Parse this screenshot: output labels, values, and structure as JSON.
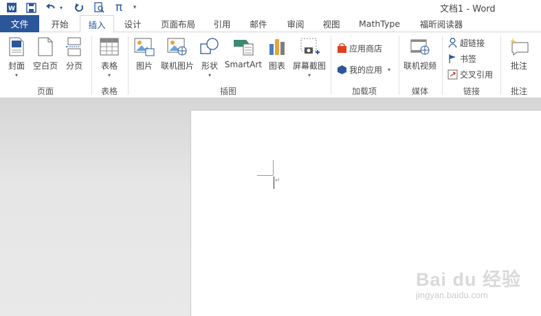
{
  "window": {
    "title": "文档1 - Word"
  },
  "quick_access": {
    "icons": [
      "word-logo-icon",
      "save-icon",
      "undo-icon",
      "redo-icon",
      "print-preview-icon",
      "pi-icon",
      "customize-icon"
    ],
    "pi_glyph": "π",
    "customize_glyph": "▾"
  },
  "tabs": {
    "file": "文件",
    "items": [
      "开始",
      "插入",
      "设计",
      "页面布局",
      "引用",
      "邮件",
      "审阅",
      "视图",
      "MathType",
      "福昕阅读器"
    ],
    "active": "插入"
  },
  "ribbon": {
    "groups": {
      "pages": "页面",
      "tables": "表格",
      "illustrations": "插图",
      "addins": "加载项",
      "media": "媒体",
      "links": "链接",
      "comments": "批注"
    },
    "buttons": {
      "cover": "封面",
      "blank_page": "空白页",
      "page_break": "分页",
      "table": "表格",
      "picture": "图片",
      "online_picture": "联机图片",
      "shapes": "形状",
      "smartart": "SmartArt",
      "chart": "图表",
      "screenshot": "屏幕截图",
      "store": "应用商店",
      "my_apps": "我的应用",
      "online_video": "联机视频",
      "hyperlink": "超链接",
      "bookmark": "书签",
      "cross_reference": "交叉引用",
      "comment": "批注"
    }
  },
  "document": {
    "paragraph_mark": "↵"
  },
  "watermark": {
    "main": "Bai du 经验",
    "sub": "jingyan.baidu.com"
  },
  "colors": {
    "accent": "#2b579a",
    "workspace": "#e6e6e6"
  }
}
